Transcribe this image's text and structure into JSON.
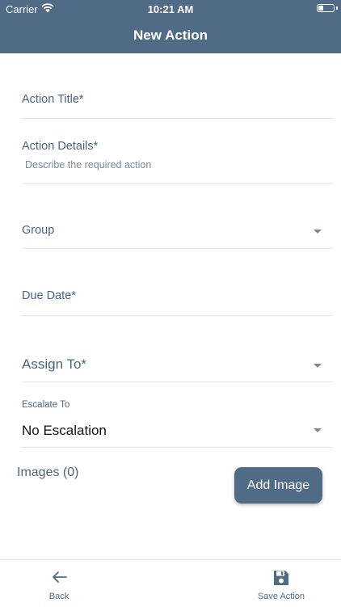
{
  "status_bar": {
    "carrier": "Carrier",
    "time": "10:21 AM",
    "battery_level": 0.35
  },
  "nav": {
    "title": "New Action"
  },
  "form": {
    "action_title": {
      "label": "Action Title*"
    },
    "action_details": {
      "label": "Action Details*",
      "placeholder": "Describe the required action"
    },
    "group": {
      "label": "Group",
      "icon": "chevron-down-icon"
    },
    "due_date": {
      "label": "Due Date*"
    },
    "assign_to": {
      "label": "Assign To*",
      "icon": "chevron-down-icon"
    },
    "escalate_to": {
      "label": "Escalate To",
      "value": "No Escalation",
      "icon": "chevron-down-icon"
    }
  },
  "images": {
    "label": "Images (0)",
    "add_button_label": "Add Image"
  },
  "tabbar": {
    "back": {
      "label": "Back",
      "icon": "arrow-left-icon"
    },
    "save": {
      "label": "Save Action",
      "icon": "save-icon"
    }
  },
  "colors": {
    "brand": "#4f6b85",
    "divider": "#e2e6ea",
    "text": "#4a6580"
  }
}
